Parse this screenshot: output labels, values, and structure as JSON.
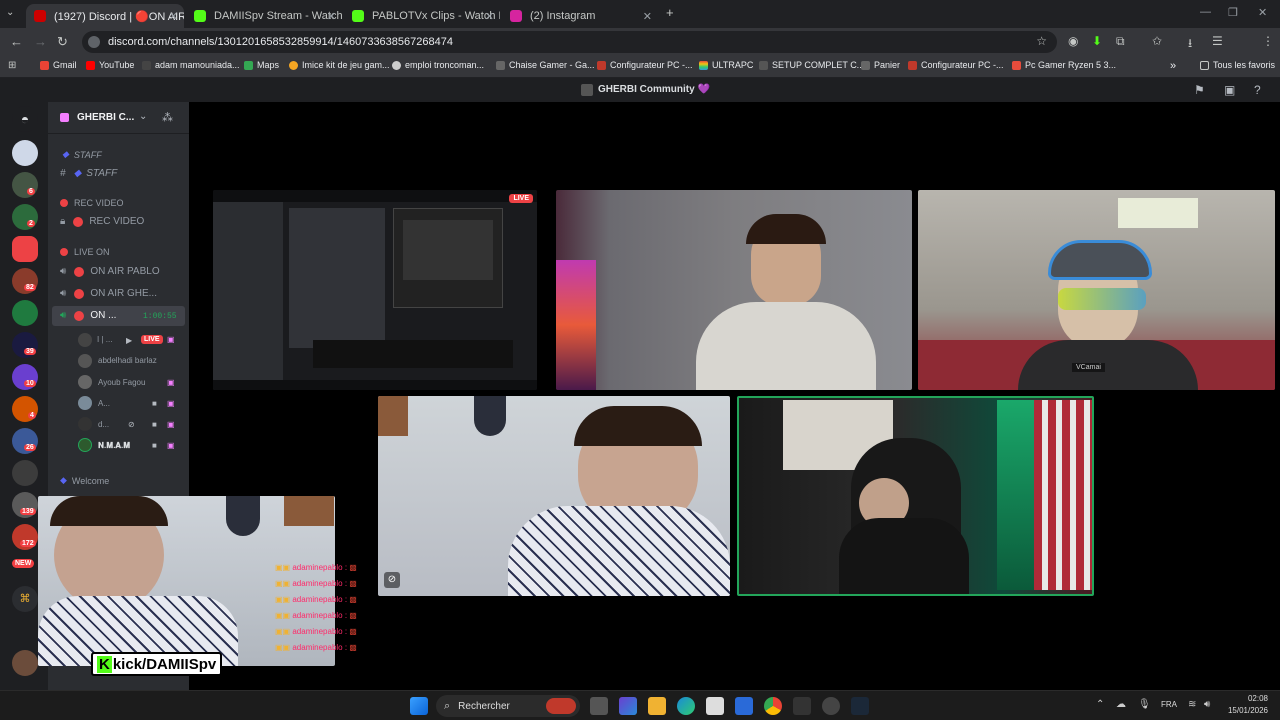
{
  "browser": {
    "tabs": [
      {
        "title": "(1927) Discord | 🔴ON AIR",
        "active": true,
        "color": "#cc0000"
      },
      {
        "title": "DAMIISpv Stream - Watch Live",
        "active": false,
        "color": "#53fc18"
      },
      {
        "title": "PABLOTVx Clips - Watch Live o",
        "active": false,
        "color": "#53fc18"
      },
      {
        "title": "(2) Instagram",
        "active": false,
        "color": "#d6249f"
      }
    ],
    "new_tab": "+",
    "url": "discord.com/channels/1301201658532859914/1460733638567268474",
    "bookmarks": [
      "Gmail",
      "YouTube",
      "adam mamouniada...",
      "Maps",
      "Imice kit de jeu gam...",
      "emploi troncoman...",
      "Chaise Gamer - Ga...",
      "Configurateur PC -...",
      "ULTRAPC",
      "SETUP COMPLET C...",
      "Panier",
      "Configurateur PC -...",
      "Pc Gamer Ryzen 5 3..."
    ],
    "bookmarks_more": "»",
    "all_bookmarks": "Tous les favoris"
  },
  "discord": {
    "title": "GHERBI Community 💜",
    "server_name": "GHERBI C...",
    "server_badges": [
      "6",
      "2",
      "82",
      "39",
      "10",
      "4",
      "26",
      "139",
      "172"
    ],
    "new_label": "NEW",
    "channels": [
      {
        "type": "category",
        "label": "STAFF"
      },
      {
        "type": "channel",
        "label": "STAFF"
      },
      {
        "type": "category",
        "label": "REC VIDEO"
      },
      {
        "type": "channel",
        "label": "REC VIDEO"
      },
      {
        "type": "category",
        "label": "LIVE ON"
      },
      {
        "type": "voice",
        "label": "ON AIR PABLO"
      },
      {
        "type": "voice",
        "label": "ON AIR GHE..."
      },
      {
        "type": "voice",
        "label": "ON ...",
        "timer": "1:00:55"
      }
    ],
    "members": [
      {
        "name": "I | ...",
        "live": "LIVE"
      },
      {
        "name": "abdelhadi barlaz"
      },
      {
        "name": "Ayoub Fagou"
      },
      {
        "name": "A..."
      },
      {
        "name": "d..."
      },
      {
        "name": "𝐍.𝐌.𝐀.𝐌"
      }
    ],
    "welcome_category": "Welcome",
    "stream_live": "LIVE",
    "overlay_handle": "kick/DAMIISpv",
    "chat_user": "adaminepablo",
    "webcam_tag": "VCamai"
  },
  "taskbar": {
    "search": "Rechercher",
    "lang": "FRA",
    "time": "02:08",
    "date": "15/01/2026"
  },
  "colors": {
    "discord_dark": "#1e1f22",
    "sidebar": "#2b2d31",
    "live_red": "#ed4245",
    "speaking_green": "#23a55a",
    "kick_green": "#53fc18"
  }
}
